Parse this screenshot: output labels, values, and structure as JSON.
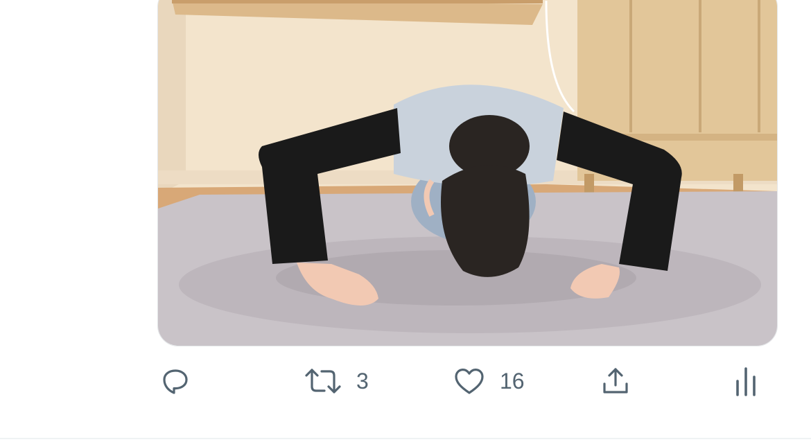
{
  "media": {
    "icon": "photo",
    "colors": {
      "wall": "#f3e4cc",
      "carpet": "#c9c3c8",
      "shelf": "#dcb98a",
      "cabinet": "#e2c699",
      "sweater": "#1a1a1a",
      "vest": "#c9d2dc",
      "hair": "#2a2522",
      "skin": "#f2c9b3"
    }
  },
  "actions": {
    "reply": {
      "icon": "reply-icon",
      "count": ""
    },
    "retweet": {
      "icon": "retweet-icon",
      "count": "3"
    },
    "like": {
      "icon": "heart-icon",
      "count": "16"
    },
    "share": {
      "icon": "share-icon"
    },
    "analytics": {
      "icon": "analytics-icon"
    }
  },
  "colors": {
    "icon": "#536471",
    "divider": "#eff3f4",
    "background": "#ffffff"
  }
}
